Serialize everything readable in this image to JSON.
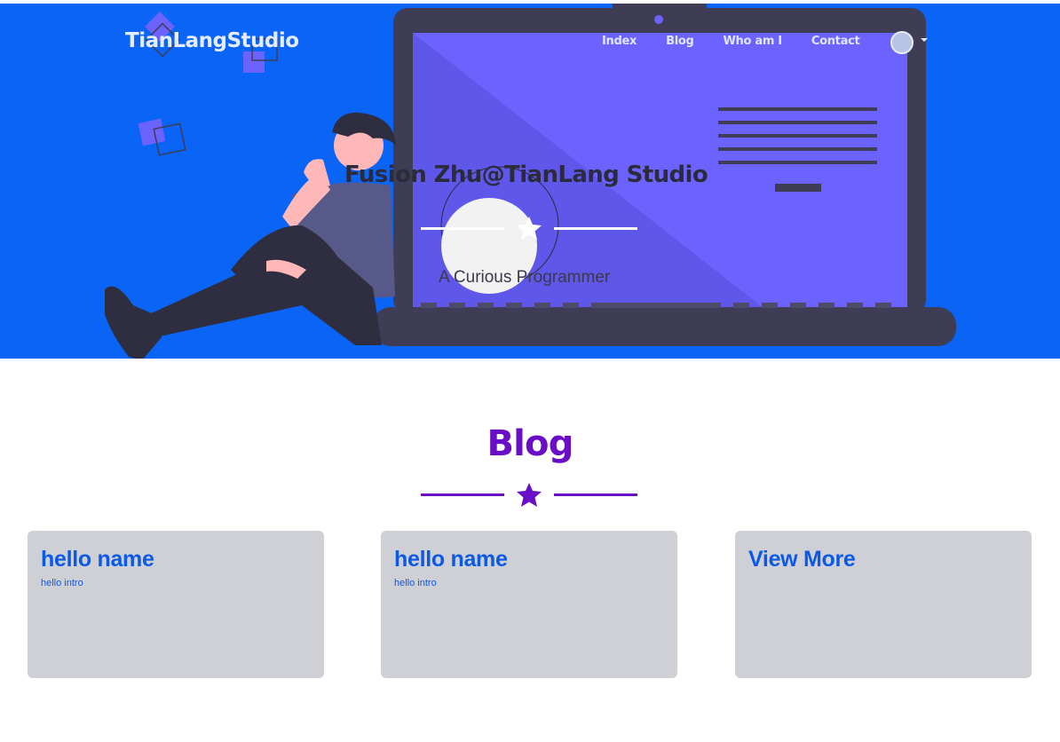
{
  "header": {
    "brand": "TianLangStudio",
    "nav": [
      "Index",
      "Blog",
      "Who am I",
      "Contact"
    ]
  },
  "hero": {
    "title": "Fusion Zhu@TianLang Studio",
    "subtitle": "A Curious Programmer",
    "divider_icon": "star-icon"
  },
  "blog": {
    "title": "Blog",
    "divider_icon": "star-icon",
    "cards": [
      {
        "title": "hello name",
        "intro": "hello intro"
      },
      {
        "title": "hello name",
        "intro": "hello intro"
      },
      {
        "title": "View More",
        "intro": ""
      }
    ]
  },
  "colors": {
    "hero_bg": "#0a64f5",
    "accent_purple": "#6a0dc7",
    "laptop_screen": "#6c63ff",
    "laptop_frame": "#3f3d56",
    "card_bg": "#cfd0d5",
    "card_text": "#0b5ae6"
  }
}
